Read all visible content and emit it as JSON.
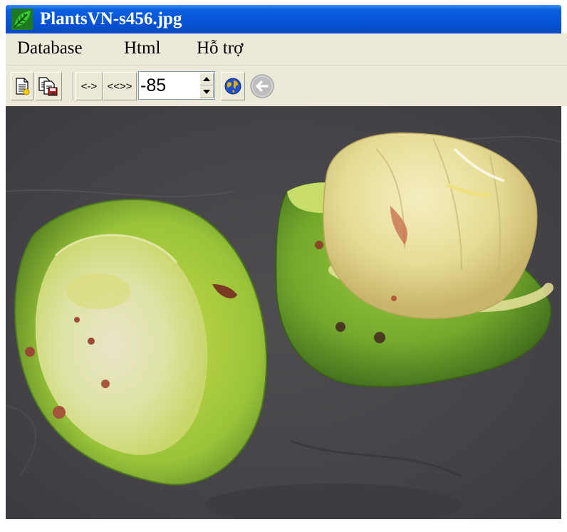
{
  "window": {
    "title": "PlantsVN-s456.jpg",
    "icon": "leaf-icon"
  },
  "menu": {
    "items": [
      {
        "label": "Database"
      },
      {
        "label": "Html"
      },
      {
        "label": "Hỗ trợ"
      }
    ]
  },
  "toolbar": {
    "new_icon": "new-page-icon",
    "save_icon": "save-copy-icon",
    "narrow_label": "<->",
    "wide_label": "<<>>",
    "spinner_value": "-85",
    "globe_icon": "globe-icon",
    "back_icon": "back-arrow-icon"
  },
  "image": {
    "subject": "photo",
    "description_visible": ""
  },
  "colors": {
    "titlebar": "#0653d6",
    "chrome": "#ece9d8",
    "title_text": "#ffffff"
  }
}
